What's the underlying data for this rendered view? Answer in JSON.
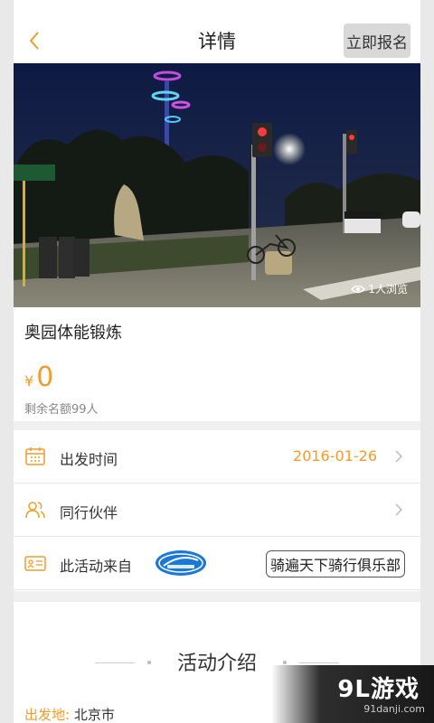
{
  "header": {
    "title": "详情",
    "signup_label": "立即报名"
  },
  "hero": {
    "views": "1人浏览"
  },
  "event": {
    "name": "奥园体能锻炼",
    "currency": "¥",
    "price": "0",
    "remaining": "剩余名额99人"
  },
  "rows": {
    "depart_time": {
      "label": "出发时间",
      "value": "2016-01-26"
    },
    "companions": {
      "label": "同行伙伴"
    },
    "source": {
      "label": "此活动来自",
      "club_name": "骑遍天下骑行俱乐部"
    }
  },
  "intro": {
    "title": "活动介绍",
    "depart_key": "出发地:",
    "depart_value": "北京市"
  },
  "watermark": {
    "main": "9L游戏",
    "sub": "91danji.com"
  },
  "colors": {
    "accent": "#f39c2b",
    "button_bg": "#d9d9d9",
    "divider": "#f0f0f0"
  }
}
